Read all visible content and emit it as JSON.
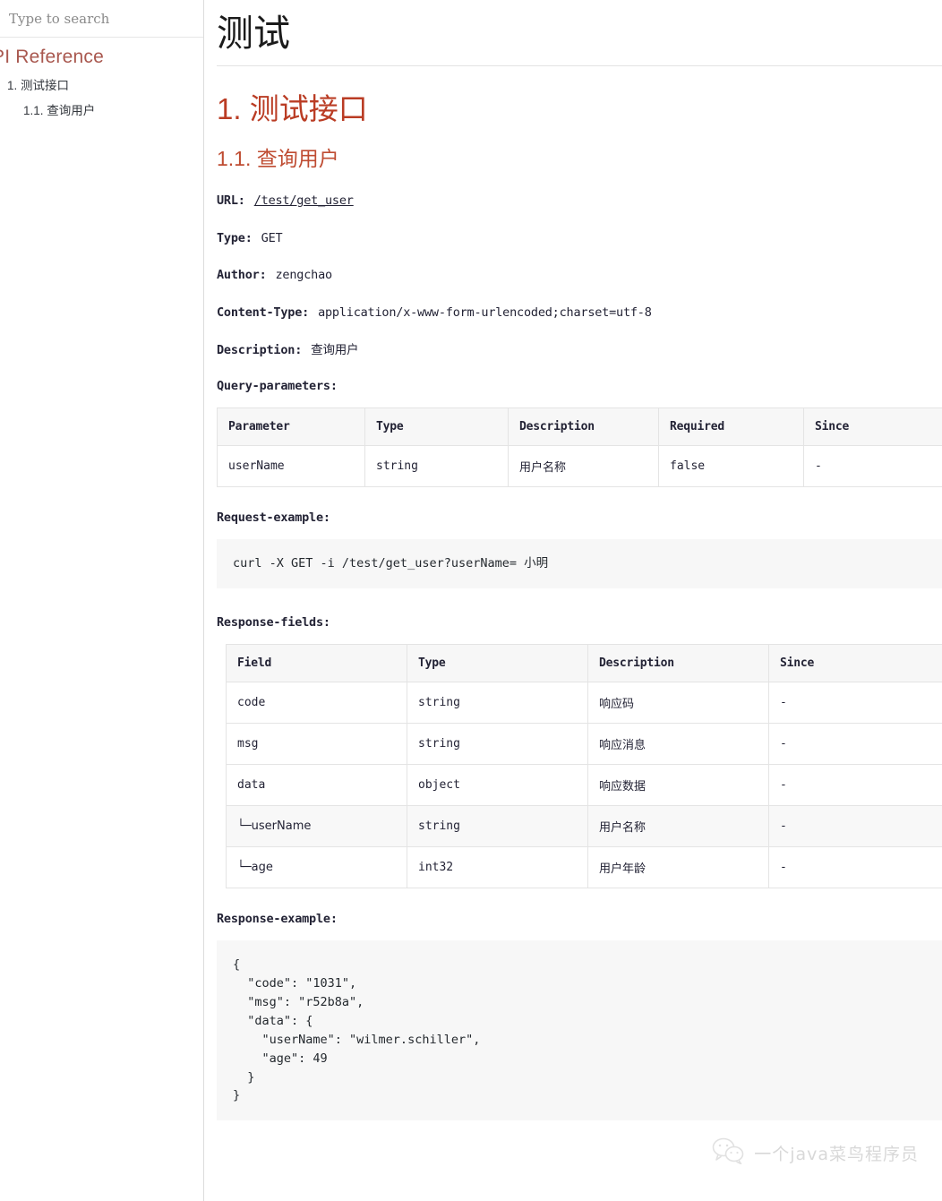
{
  "sidebar": {
    "search": {
      "placeholder": "Type to search",
      "value": ""
    },
    "title": "PI Reference",
    "items": [
      {
        "label": "1. 测试接口",
        "level": 1
      },
      {
        "label": "1.1. 查询用户",
        "level": 2
      }
    ]
  },
  "content": {
    "doc_title": "测试",
    "h1": "1. 测试接口",
    "h2": "1.1. 查询用户",
    "meta": {
      "url_label": "URL:",
      "url_value": "/test/get_user",
      "type_label": "Type:",
      "type_value": "GET",
      "author_label": "Author:",
      "author_value": "zengchao",
      "content_type_label": "Content-Type:",
      "content_type_value": "application/x-www-form-urlencoded;charset=utf-8",
      "description_label": "Description:",
      "description_value": "查询用户"
    },
    "query_parameters": {
      "label": "Query-parameters:",
      "columns": [
        "Parameter",
        "Type",
        "Description",
        "Required",
        "Since"
      ],
      "rows": [
        [
          "userName",
          "string",
          "用户名称",
          "false",
          "-"
        ]
      ]
    },
    "request_example": {
      "label": "Request-example:",
      "code": "curl -X GET -i /test/get_user?userName= 小明"
    },
    "response_fields": {
      "label": "Response-fields:",
      "columns": [
        "Field",
        "Type",
        "Description",
        "Since"
      ],
      "rows": [
        [
          "code",
          "string",
          "响应码",
          "-"
        ],
        [
          "msg",
          "string",
          "响应消息",
          "-"
        ],
        [
          "data",
          "object",
          "响应数据",
          "-"
        ],
        [
          "└─userName",
          "string",
          "用户名称",
          "-"
        ],
        [
          "└─age",
          "int32",
          "用户年龄",
          "-"
        ]
      ]
    },
    "response_example": {
      "label": "Response-example:",
      "code": "{\n  \"code\": \"1031\",\n  \"msg\": \"r52b8a\",\n  \"data\": {\n    \"userName\": \"wilmer.schiller\",\n    \"age\": 49\n  }\n}"
    }
  },
  "watermark": {
    "icon": "wechat-icon",
    "text": "一个java菜鸟程序员"
  },
  "colors": {
    "heading_primary": "#ba3c24",
    "heading_secondary": "#bf4c32",
    "sidebar_title": "#a9584f",
    "code_bg": "#f7f7f7",
    "table_header_bg": "#f7f7f7"
  }
}
